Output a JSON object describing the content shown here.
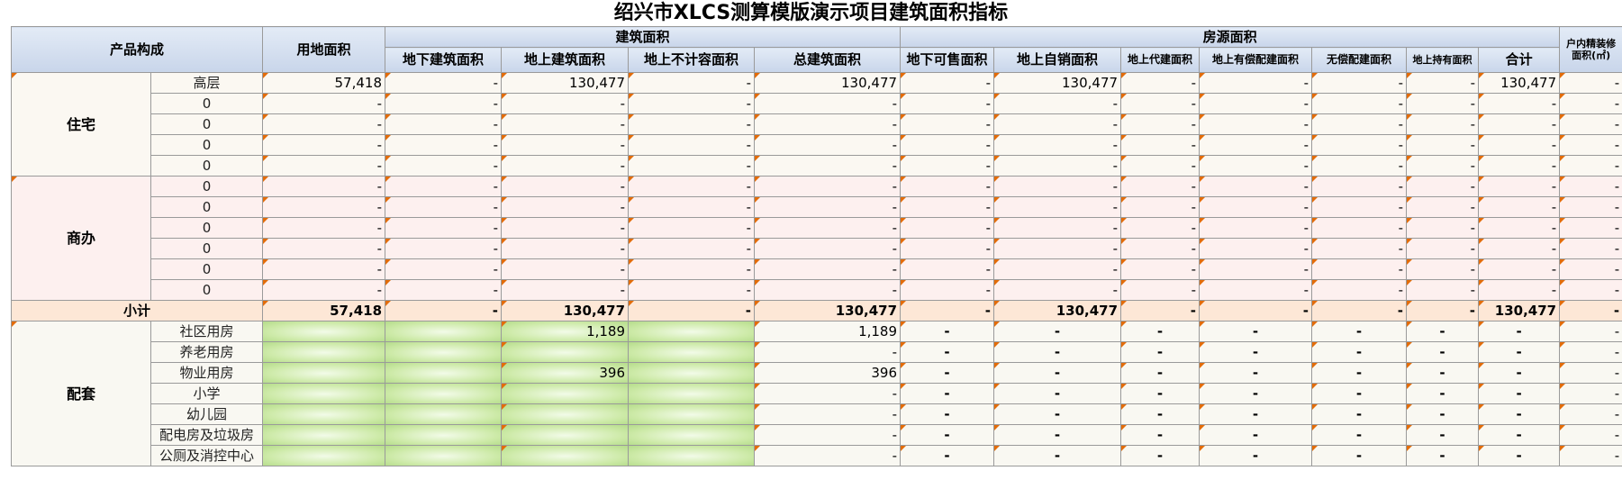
{
  "title": "绍兴市XLCS测算模版演示项目建筑面积指标",
  "corner_mark": "-",
  "headers": {
    "product": "产品构成",
    "land_area": "用地面积",
    "building_area": "建筑面积",
    "underground": "地下建筑面积",
    "above_ground": "地上建筑面积",
    "above_excluded": "地上不计容面积",
    "total": "总建筑面积",
    "housing_area": "房源面积",
    "under_sale": "地下可售面积",
    "above_self_sale": "地上自销面积",
    "above_agent": "地上代建面积",
    "above_paid_supp": "地上有偿配建面积",
    "free_supp": "无偿配建面积",
    "above_hold": "地上持有面积",
    "sum": "合计",
    "decor": "户内精装修面积(㎡)"
  },
  "residential": {
    "label": "住宅",
    "rows": [
      {
        "name": "高层",
        "cells": [
          "57,418",
          "-",
          "130,477",
          "-",
          "130,477",
          "-",
          "130,477",
          "-",
          "-",
          "-",
          "-",
          "130,477",
          "-"
        ]
      },
      {
        "name": "0",
        "cells": [
          "-",
          "-",
          "-",
          "-",
          "-",
          "-",
          "-",
          "-",
          "-",
          "-",
          "-",
          "-",
          "-"
        ]
      },
      {
        "name": "0",
        "cells": [
          "-",
          "-",
          "-",
          "-",
          "-",
          "-",
          "-",
          "-",
          "-",
          "-",
          "-",
          "-",
          "-"
        ]
      },
      {
        "name": "0",
        "cells": [
          "-",
          "-",
          "-",
          "-",
          "-",
          "-",
          "-",
          "-",
          "-",
          "-",
          "-",
          "-",
          "-"
        ]
      },
      {
        "name": "0",
        "cells": [
          "-",
          "-",
          "-",
          "-",
          "-",
          "-",
          "-",
          "-",
          "-",
          "-",
          "-",
          "-",
          "-"
        ]
      }
    ]
  },
  "commercial": {
    "label": "商办",
    "rows": [
      {
        "name": "0",
        "cells": [
          "-",
          "-",
          "-",
          "-",
          "-",
          "-",
          "-",
          "-",
          "-",
          "-",
          "-",
          "-",
          "-"
        ]
      },
      {
        "name": "0",
        "cells": [
          "-",
          "-",
          "-",
          "-",
          "-",
          "-",
          "-",
          "-",
          "-",
          "-",
          "-",
          "-",
          "-"
        ]
      },
      {
        "name": "0",
        "cells": [
          "-",
          "-",
          "-",
          "-",
          "-",
          "-",
          "-",
          "-",
          "-",
          "-",
          "-",
          "-",
          "-"
        ]
      },
      {
        "name": "0",
        "cells": [
          "-",
          "-",
          "-",
          "-",
          "-",
          "-",
          "-",
          "-",
          "-",
          "-",
          "-",
          "-",
          "-"
        ]
      },
      {
        "name": "0",
        "cells": [
          "-",
          "-",
          "-",
          "-",
          "-",
          "-",
          "-",
          "-",
          "-",
          "-",
          "-",
          "-",
          "-"
        ]
      },
      {
        "name": "0",
        "cells": [
          "-",
          "-",
          "-",
          "-",
          "-",
          "-",
          "-",
          "-",
          "-",
          "-",
          "-",
          "-",
          "-"
        ]
      }
    ]
  },
  "subtotal": {
    "label": "小计",
    "cells": [
      "57,418",
      "-",
      "130,477",
      "-",
      "130,477",
      "-",
      "130,477",
      "-",
      "-",
      "-",
      "-",
      "130,477",
      "-"
    ]
  },
  "supporting": {
    "label": "配套",
    "rows": [
      {
        "name": "社区用房",
        "cells": [
          "",
          "",
          "1,189",
          "",
          "1,189",
          "-",
          "-",
          "-",
          "-",
          "-",
          "-",
          "-",
          "-"
        ]
      },
      {
        "name": "养老用房",
        "cells": [
          "",
          "",
          "",
          "",
          "-",
          "-",
          "-",
          "-",
          "-",
          "-",
          "-",
          "-",
          "-"
        ]
      },
      {
        "name": "物业用房",
        "cells": [
          "",
          "",
          "396",
          "",
          "396",
          "-",
          "-",
          "-",
          "-",
          "-",
          "-",
          "-",
          "-"
        ]
      },
      {
        "name": "小学",
        "cells": [
          "",
          "",
          "",
          "",
          "-",
          "-",
          "-",
          "-",
          "-",
          "-",
          "-",
          "-",
          "-"
        ]
      },
      {
        "name": "幼儿园",
        "cells": [
          "",
          "",
          "",
          "",
          "-",
          "-",
          "-",
          "-",
          "-",
          "-",
          "-",
          "-",
          "-"
        ]
      },
      {
        "name": "配电房及垃圾房",
        "cells": [
          "",
          "",
          "",
          "",
          "-",
          "-",
          "-",
          "-",
          "-",
          "-",
          "-",
          "-",
          "-"
        ]
      },
      {
        "name": "公厕及消控中心",
        "cells": [
          "",
          "",
          "",
          "",
          "-",
          "-",
          "-",
          "-",
          "-",
          "-",
          "-",
          "-",
          "-"
        ]
      }
    ]
  }
}
